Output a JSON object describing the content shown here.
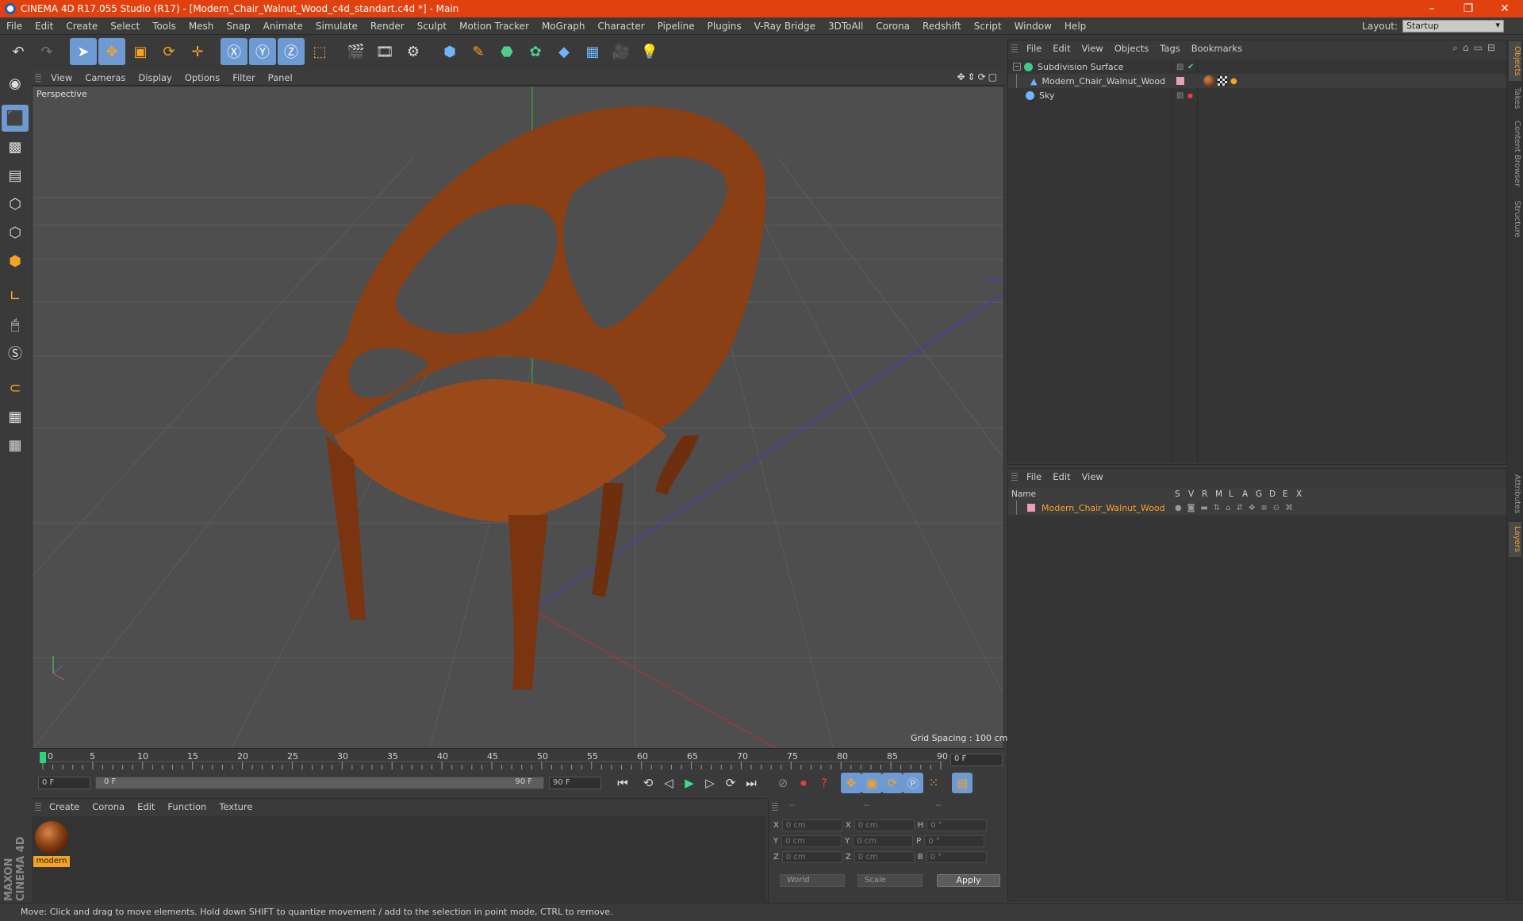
{
  "app": {
    "title": "CINEMA 4D R17.055 Studio (R17) - [Modern_Chair_Walnut_Wood_c4d_standart.c4d *] - Main"
  },
  "menu": [
    "File",
    "Edit",
    "Create",
    "Select",
    "Tools",
    "Mesh",
    "Snap",
    "Animate",
    "Simulate",
    "Render",
    "Sculpt",
    "Motion Tracker",
    "MoGraph",
    "Character",
    "Pipeline",
    "Plugins",
    "V-Ray Bridge",
    "3DToAll",
    "Corona",
    "Redshift",
    "Script",
    "Window",
    "Help"
  ],
  "layout": {
    "label": "Layout:",
    "value": "Startup"
  },
  "viewport": {
    "menu": [
      "View",
      "Cameras",
      "Display",
      "Options",
      "Filter",
      "Panel"
    ],
    "label": "Perspective",
    "grid_spacing": "Grid Spacing : 100 cm"
  },
  "timeline": {
    "ticks": [
      "0",
      "5",
      "10",
      "15",
      "20",
      "25",
      "30",
      "35",
      "40",
      "45",
      "50",
      "55",
      "60",
      "65",
      "70",
      "75",
      "80",
      "85",
      "90"
    ],
    "current_frame": "0 F",
    "start_field": "0 F",
    "slider_start": "0 F",
    "slider_end": "90 F",
    "end_field": "90 F"
  },
  "material_manager": {
    "menu": [
      "Create",
      "Corona",
      "Edit",
      "Function",
      "Texture"
    ],
    "materials": [
      {
        "name": "modern"
      }
    ]
  },
  "coordinates": {
    "headers": [
      "--",
      "--",
      "--"
    ],
    "rows": [
      {
        "a": "X",
        "av": "0 cm",
        "b": "X",
        "bv": "0 cm",
        "c": "H",
        "cv": "0 °"
      },
      {
        "a": "Y",
        "av": "0 cm",
        "b": "Y",
        "bv": "0 cm",
        "c": "P",
        "cv": "0 °"
      },
      {
        "a": "Z",
        "av": "0 cm",
        "b": "Z",
        "bv": "0 cm",
        "c": "B",
        "cv": "0 °"
      }
    ],
    "space": "World",
    "mode": "Scale",
    "apply": "Apply"
  },
  "object_manager": {
    "menu": [
      "File",
      "Edit",
      "View",
      "Objects",
      "Tags",
      "Bookmarks"
    ],
    "objects": [
      {
        "name": "Subdivision Surface"
      },
      {
        "name": "Modern_Chair_Walnut_Wood"
      },
      {
        "name": "Sky"
      }
    ]
  },
  "layer_manager": {
    "menu": [
      "File",
      "Edit",
      "View"
    ],
    "columns": [
      "Name",
      "S",
      "V",
      "R",
      "M",
      "L",
      "A",
      "G",
      "D",
      "E",
      "X"
    ],
    "layers": [
      {
        "name": "Modern_Chair_Walnut_Wood"
      }
    ]
  },
  "right_tabs": [
    "Objects",
    "Takes",
    "Content Browser",
    "Structure",
    "Attributes",
    "Layers"
  ],
  "status": "Move: Click and drag to move elements. Hold down SHIFT to quantize movement / add to the selection in point mode, CTRL to remove.",
  "brand": "MAXON CINEMA 4D",
  "colors": {
    "titlebar": "#e1410e",
    "accent": "#6e9ad4",
    "highlight": "#f6a324"
  }
}
